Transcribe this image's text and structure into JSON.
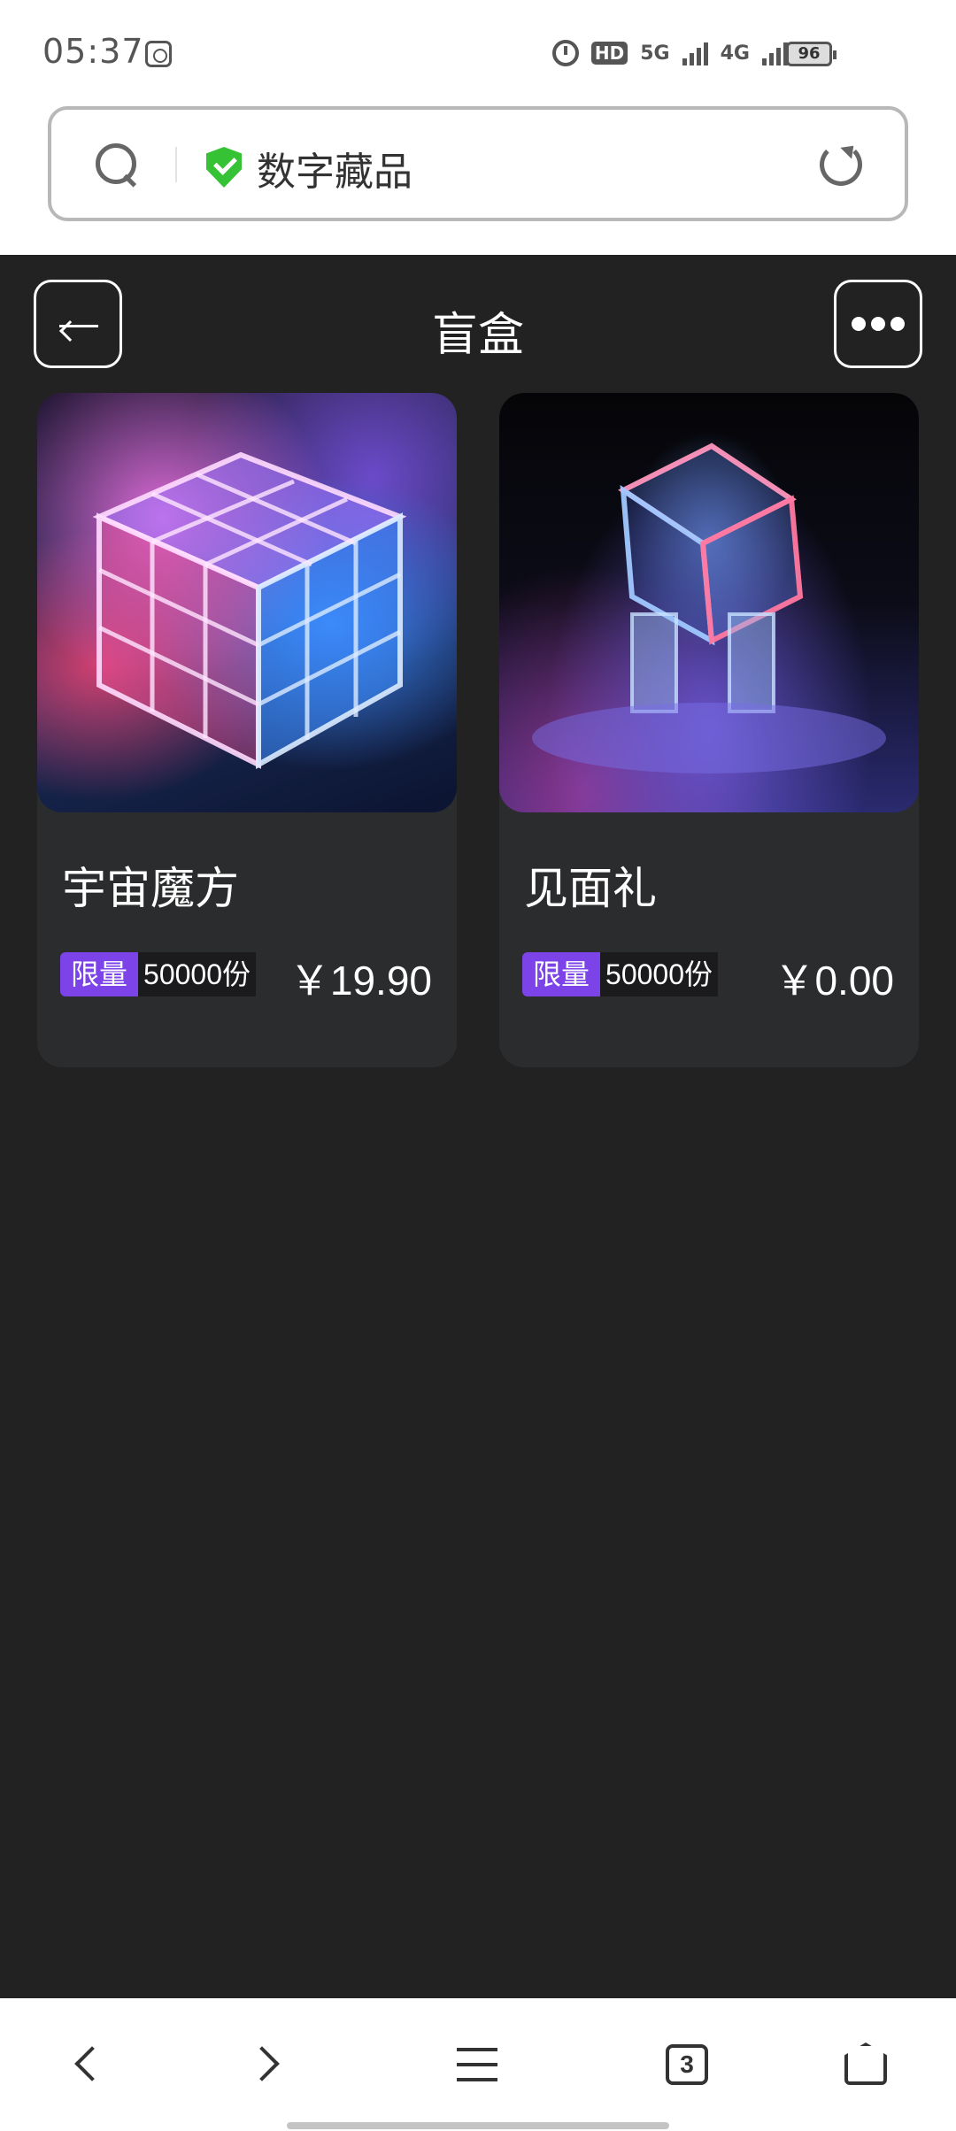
{
  "status_bar": {
    "time": "05:37",
    "network_5g": "5G",
    "network_4g": "4G",
    "hd_label": "HD",
    "battery": "96",
    "icons": [
      "app-icon",
      "alarm-icon",
      "hd-icon",
      "signal-icon",
      "wifi-icon",
      "battery-icon"
    ]
  },
  "browser": {
    "address_text": "数字藏品",
    "icons": [
      "search-icon",
      "shield-check-icon",
      "reload-icon"
    ],
    "secure_color": "#35c235"
  },
  "header": {
    "title": "盲盒"
  },
  "products": [
    {
      "name": "宇宙魔方",
      "tag_label": "限量",
      "tag_count": "50000份",
      "price": "￥19.90"
    },
    {
      "name": "见面礼",
      "tag_label": "限量",
      "tag_count": "50000份",
      "price": "￥0.00"
    }
  ],
  "bottom_nav": {
    "tab_count": "3",
    "icons": [
      "back-icon",
      "forward-icon",
      "menu-icon",
      "tabs-icon",
      "home-icon"
    ]
  },
  "colors": {
    "background": "#222222",
    "card": "#2b2c2e",
    "tag_accent": "#7b43e8"
  }
}
